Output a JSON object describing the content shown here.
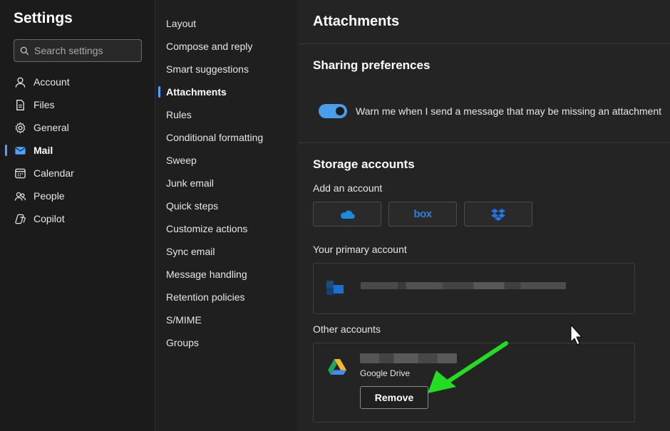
{
  "settings": {
    "title": "Settings",
    "search_placeholder": "Search settings"
  },
  "nav": {
    "items": [
      {
        "label": "Account",
        "icon": "person-icon",
        "active": false
      },
      {
        "label": "Files",
        "icon": "file-icon",
        "active": false
      },
      {
        "label": "General",
        "icon": "gear-icon",
        "active": false
      },
      {
        "label": "Mail",
        "icon": "mail-icon",
        "active": true
      },
      {
        "label": "Calendar",
        "icon": "calendar-icon",
        "active": false
      },
      {
        "label": "People",
        "icon": "people-icon",
        "active": false
      },
      {
        "label": "Copilot",
        "icon": "copilot-icon",
        "active": false
      }
    ]
  },
  "mail_settings": {
    "items": [
      "Layout",
      "Compose and reply",
      "Smart suggestions",
      "Attachments",
      "Rules",
      "Conditional formatting",
      "Sweep",
      "Junk email",
      "Quick steps",
      "Customize actions",
      "Sync email",
      "Message handling",
      "Retention policies",
      "S/MIME",
      "Groups"
    ],
    "active_index": 3
  },
  "attachments": {
    "title": "Attachments",
    "sharing": {
      "title": "Sharing preferences",
      "toggle_label": "Warn me when I send a message that may be missing an attachment",
      "toggle_on": true
    },
    "storage": {
      "title": "Storage accounts",
      "add_label": "Add an account",
      "providers": [
        {
          "name": "OneDrive",
          "icon": "onedrive-icon"
        },
        {
          "name": "box",
          "icon": "box-logo"
        },
        {
          "name": "Dropbox",
          "icon": "dropbox-icon"
        }
      ],
      "primary_label": "Your primary account",
      "other_label": "Other accounts",
      "other_account": {
        "service": "Google Drive",
        "remove_label": "Remove"
      }
    }
  },
  "colors": {
    "accent": "#4da3ff",
    "toggle": "#4a9de8",
    "annotation_arrow": "#22dd22"
  }
}
